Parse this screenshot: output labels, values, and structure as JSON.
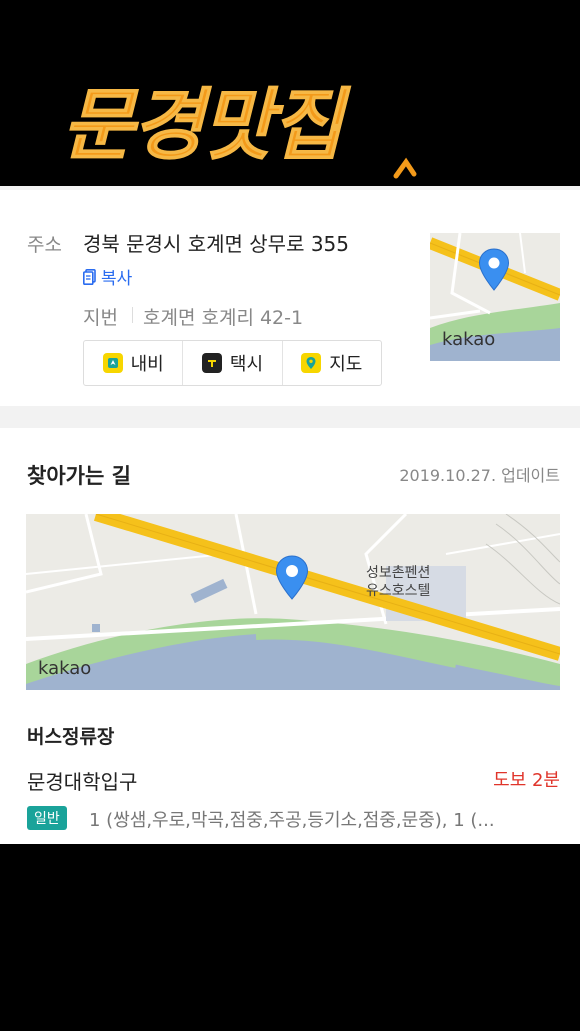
{
  "banner": {
    "title": "문경맛집"
  },
  "address": {
    "label": "주소",
    "road": "경북 문경시 호계면 상무로 355",
    "copy_label": "복사",
    "jibeon_label": "지번",
    "jibeon_value": "호계면 호계리 42-1",
    "map_logo": "kakao",
    "buttons": [
      {
        "label": "내비",
        "icon": "navi-icon",
        "color": "#f7d600"
      },
      {
        "label": "택시",
        "icon": "taxi-icon",
        "color": "#222222"
      },
      {
        "label": "지도",
        "icon": "map-pin-icon",
        "color": "#f7d600"
      }
    ]
  },
  "route": {
    "title": "찾아가는 길",
    "updated": "2019.10.27. 업데이트",
    "map_logo": "kakao",
    "map_place_label_line1": "성보촌펜션",
    "map_place_label_line2": "유스호스텔"
  },
  "bus": {
    "heading": "버스정류장",
    "stop_name": "문경대학입구",
    "walk_time": "도보 2분",
    "badge": "일반",
    "routes": "1 (쌍샘,우로,막곡,점중,주공,등기소,점중,문중), 1 (..."
  },
  "colors": {
    "accent_blue": "#2a6cf0",
    "walk_red": "#e0342a",
    "badge_teal": "#1aa39a",
    "road_yellow": "#f5c11b",
    "river_blue": "#9fb3cf",
    "park_green": "#a8d59a",
    "banner_orange": "#f39a1a"
  }
}
